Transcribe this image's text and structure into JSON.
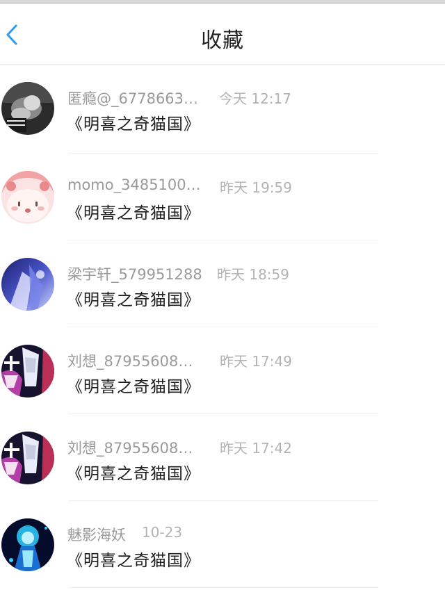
{
  "header": {
    "title": "收藏",
    "back_icon": "chevron-left-icon",
    "accent_color": "#2f9bf0"
  },
  "items": [
    {
      "username": "匿瘾@_6778663…",
      "time": "今天 12:17",
      "title": "《明喜之奇猫国》",
      "avatar": "photo-avatar-dark"
    },
    {
      "username": "momo_3485100…",
      "time": "昨天 19:59",
      "title": "《明喜之奇猫国》",
      "avatar": "cartoon-pink-avatar"
    },
    {
      "username": "梁宇轩_579951288",
      "time": "昨天 18:59",
      "title": "《明喜之奇猫国》",
      "avatar": "anime-blue-avatar"
    },
    {
      "username": "刘想_87955608…",
      "time": "昨天 17:49",
      "title": "《明喜之奇猫国》",
      "avatar": "anime-neon-avatar"
    },
    {
      "username": "刘想_87955608…",
      "time": "昨天 17:42",
      "title": "《明喜之奇猫国》",
      "avatar": "anime-neon-avatar"
    },
    {
      "username": "魅影海妖",
      "time": "10-23",
      "title": "《明喜之奇猫国》",
      "avatar": "anime-cyan-avatar"
    }
  ]
}
